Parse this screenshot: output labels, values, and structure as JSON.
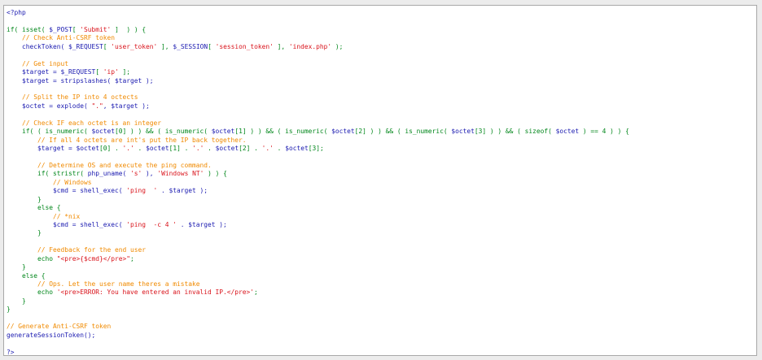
{
  "colors": {
    "code": "#1a1ab0",
    "keyword": "#00861a",
    "string": "#d9131b",
    "comment": "#f08a00",
    "background": "#ffffff",
    "border": "#a8a8a8"
  },
  "lines": [
    [
      [
        "code",
        "<?php"
      ]
    ],
    [],
    [
      [
        "kw",
        "if( isset( "
      ],
      [
        "code",
        "$_POST"
      ],
      [
        "kw",
        "[ "
      ],
      [
        "str",
        "'Submit'"
      ],
      [
        "kw",
        " ]  ) ) {"
      ]
    ],
    [
      [
        "kw",
        "    "
      ],
      [
        "com",
        "// Check Anti-CSRF token"
      ]
    ],
    [
      [
        "code",
        "    checkToken( $_REQUEST"
      ],
      [
        "kw",
        "[ "
      ],
      [
        "str",
        "'user_token'"
      ],
      [
        "kw",
        " ], "
      ],
      [
        "code",
        "$_SESSION"
      ],
      [
        "kw",
        "[ "
      ],
      [
        "str",
        "'session_token'"
      ],
      [
        "kw",
        " ], "
      ],
      [
        "str",
        "'index.php'"
      ],
      [
        "kw",
        " );"
      ]
    ],
    [],
    [
      [
        "com",
        "    // Get input"
      ]
    ],
    [
      [
        "code",
        "    $target = $_REQUEST"
      ],
      [
        "kw",
        "[ "
      ],
      [
        "str",
        "'ip'"
      ],
      [
        "kw",
        " ];"
      ]
    ],
    [
      [
        "code",
        "    $target = stripslashes( $target );"
      ]
    ],
    [],
    [
      [
        "com",
        "    // Split the IP into 4 octects"
      ]
    ],
    [
      [
        "code",
        "    $octet = explode( "
      ],
      [
        "str",
        "\".\""
      ],
      [
        "code",
        ", $target );"
      ]
    ],
    [],
    [
      [
        "com",
        "    // Check IF each octet is an integer"
      ]
    ],
    [
      [
        "kw",
        "    if( ( is_numeric( "
      ],
      [
        "code",
        "$octet"
      ],
      [
        "kw",
        "[0] ) ) && ( is_numeric( "
      ],
      [
        "code",
        "$octet"
      ],
      [
        "kw",
        "[1] ) ) && ( is_numeric( "
      ],
      [
        "code",
        "$octet"
      ],
      [
        "kw",
        "[2] ) ) && ( is_numeric( "
      ],
      [
        "code",
        "$octet"
      ],
      [
        "kw",
        "[3] ) ) && ( sizeof( "
      ],
      [
        "code",
        "$octet"
      ],
      [
        "kw",
        " ) == 4 ) ) {"
      ]
    ],
    [
      [
        "com",
        "        // If all 4 octets are int's put the IP back together."
      ]
    ],
    [
      [
        "code",
        "        $target = $octet"
      ],
      [
        "kw",
        "[0] . "
      ],
      [
        "str",
        "'.'"
      ],
      [
        "kw",
        " . "
      ],
      [
        "code",
        "$octet"
      ],
      [
        "kw",
        "[1] . "
      ],
      [
        "str",
        "'.'"
      ],
      [
        "kw",
        " . "
      ],
      [
        "code",
        "$octet"
      ],
      [
        "kw",
        "[2] . "
      ],
      [
        "str",
        "'.'"
      ],
      [
        "kw",
        " . "
      ],
      [
        "code",
        "$octet"
      ],
      [
        "kw",
        "[3];"
      ]
    ],
    [],
    [
      [
        "com",
        "        // Determine OS and execute the ping command."
      ]
    ],
    [
      [
        "kw",
        "        if( stristr( "
      ],
      [
        "code",
        "php_uname( "
      ],
      [
        "str",
        "'s'"
      ],
      [
        "code",
        " ), "
      ],
      [
        "str",
        "'Windows NT'"
      ],
      [
        "kw",
        " ) ) {"
      ]
    ],
    [
      [
        "com",
        "            // Windows"
      ]
    ],
    [
      [
        "code",
        "            $cmd = shell_exec( "
      ],
      [
        "str",
        "'ping  '"
      ],
      [
        "code",
        " . $target );"
      ]
    ],
    [
      [
        "kw",
        "        }"
      ]
    ],
    [
      [
        "kw",
        "        else {"
      ]
    ],
    [
      [
        "com",
        "            // *nix"
      ]
    ],
    [
      [
        "code",
        "            $cmd = shell_exec( "
      ],
      [
        "str",
        "'ping  -c 4 '"
      ],
      [
        "code",
        " . $target );"
      ]
    ],
    [
      [
        "kw",
        "        }"
      ]
    ],
    [],
    [
      [
        "com",
        "        // Feedback for the end user"
      ]
    ],
    [
      [
        "kw",
        "        echo "
      ],
      [
        "str",
        "\"<pre>{$cmd}</pre>\""
      ],
      [
        "kw",
        ";"
      ]
    ],
    [
      [
        "kw",
        "    }"
      ]
    ],
    [
      [
        "kw",
        "    else {"
      ]
    ],
    [
      [
        "com",
        "        // Ops. Let the user name theres a mistake"
      ]
    ],
    [
      [
        "kw",
        "        echo "
      ],
      [
        "str",
        "'<pre>ERROR: You have entered an invalid IP.</pre>'"
      ],
      [
        "kw",
        ";"
      ]
    ],
    [
      [
        "kw",
        "    }"
      ]
    ],
    [
      [
        "kw",
        "}"
      ]
    ],
    [],
    [
      [
        "com",
        "// Generate Anti-CSRF token"
      ]
    ],
    [
      [
        "code",
        "generateSessionToken();"
      ]
    ],
    [],
    [
      [
        "code",
        "?>"
      ]
    ]
  ]
}
